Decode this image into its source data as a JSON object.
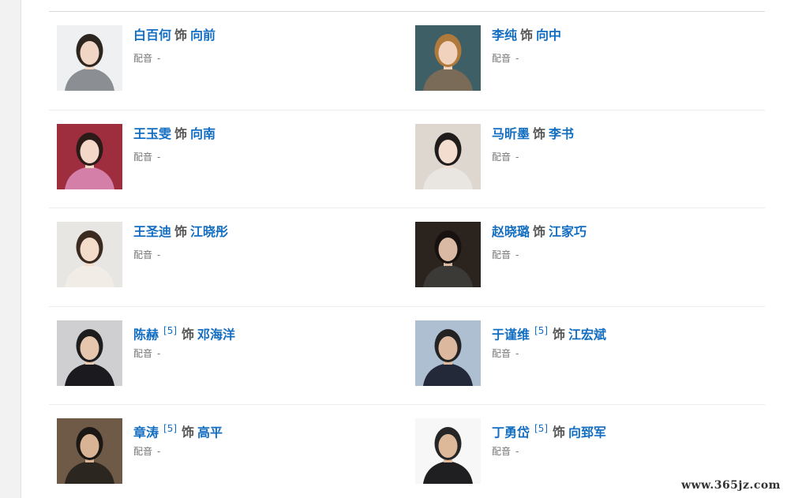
{
  "cast": [
    {
      "actor": "白百何",
      "as_text": "饰",
      "role": "向前",
      "ref": "",
      "voice_label": "配音",
      "voice_value": "-",
      "photo": {
        "bg": "#eef0f2",
        "hair": "#2d2520",
        "skin": "#f1d6c5",
        "cloth": "#8b8f93"
      }
    },
    {
      "actor": "李纯",
      "as_text": "饰",
      "role": "向中",
      "ref": "",
      "voice_label": "配音",
      "voice_value": "-",
      "photo": {
        "bg": "#3f5f66",
        "hair": "#b07a3c",
        "skin": "#f0d2bd",
        "cloth": "#7a6a58"
      }
    },
    {
      "actor": "王玉雯",
      "as_text": "饰",
      "role": "向南",
      "ref": "",
      "voice_label": "配音",
      "voice_value": "-",
      "photo": {
        "bg": "#9e2d3e",
        "hair": "#2a1a18",
        "skin": "#f3d8c8",
        "cloth": "#d47fa8"
      }
    },
    {
      "actor": "马昕墨",
      "as_text": "饰",
      "role": "李书",
      "ref": "",
      "voice_label": "配音",
      "voice_value": "-",
      "photo": {
        "bg": "#ddd7cf",
        "hair": "#1f1c1b",
        "skin": "#f3ddcf",
        "cloth": "#e9e6e2"
      }
    },
    {
      "actor": "王圣迪",
      "as_text": "饰",
      "role": "江晓彤",
      "ref": "",
      "voice_label": "配音",
      "voice_value": "-",
      "photo": {
        "bg": "#e8e6e3",
        "hair": "#3a2a20",
        "skin": "#f4dccb",
        "cloth": "#f1ece6"
      }
    },
    {
      "actor": "赵晓璐",
      "as_text": "饰",
      "role": "江家巧",
      "ref": "",
      "voice_label": "配音",
      "voice_value": "-",
      "photo": {
        "bg": "#2b241e",
        "hair": "#17120f",
        "skin": "#d9b9a3",
        "cloth": "#3b3a36"
      }
    },
    {
      "actor": "陈赫",
      "as_text": "饰",
      "role": "邓海洋",
      "ref": "[5]",
      "voice_label": "配音",
      "voice_value": "-",
      "photo": {
        "bg": "#cfcfd2",
        "hair": "#1d1d1d",
        "skin": "#e6c6ad",
        "cloth": "#1b1b1f"
      }
    },
    {
      "actor": "于谨维",
      "as_text": "饰",
      "role": "江宏斌",
      "ref": "[5]",
      "voice_label": "配音",
      "voice_value": "-",
      "photo": {
        "bg": "#aebfd2",
        "hair": "#232323",
        "skin": "#dcb99e",
        "cloth": "#24293a"
      }
    },
    {
      "actor": "章涛",
      "as_text": "饰",
      "role": "高平",
      "ref": "[5]",
      "voice_label": "配音",
      "voice_value": "-",
      "photo": {
        "bg": "#6e5a47",
        "hair": "#1b1714",
        "skin": "#d8b394",
        "cloth": "#2c2621"
      }
    },
    {
      "actor": "丁勇岱",
      "as_text": "饰",
      "role": "向郅军",
      "ref": "[5]",
      "voice_label": "配音",
      "voice_value": "-",
      "photo": {
        "bg": "#f7f7f7",
        "hair": "#262626",
        "skin": "#ddb999",
        "cloth": "#1f1f22"
      }
    }
  ],
  "watermark": "www.365jz.com"
}
